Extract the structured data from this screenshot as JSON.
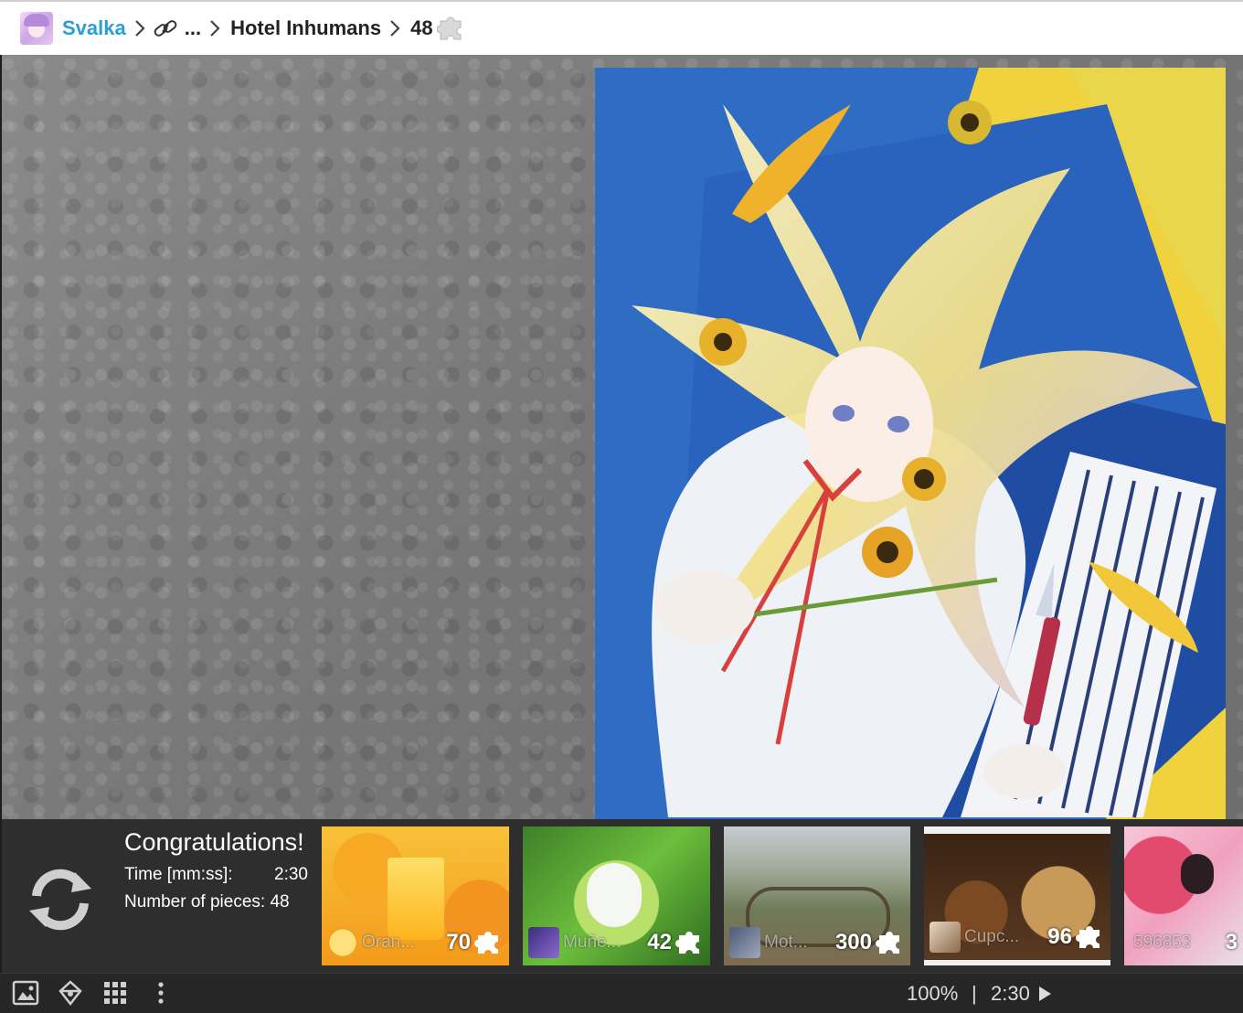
{
  "breadcrumb": {
    "user": "Svalka",
    "ellipsis": "...",
    "collection": "Hotel Inhumans",
    "pieces": "48"
  },
  "result": {
    "title": "Congratulations!",
    "time_label": "Time [mm:ss]:",
    "time_value": "2:30",
    "pieces_label": "Number of pieces: 48"
  },
  "suggestions": [
    {
      "name": "Oran...",
      "count": "70",
      "colors": [
        "#f39a1a",
        "#ffcf3a"
      ]
    },
    {
      "name": "Muñe...",
      "count": "42",
      "colors": [
        "#5aa832",
        "#b8e06a"
      ]
    },
    {
      "name": "Mot...",
      "count": "300",
      "colors": [
        "#7a7f68",
        "#c7ccd0"
      ]
    },
    {
      "name": "Cupc...",
      "count": "96",
      "colors": [
        "#3b2414",
        "#a87b4f"
      ]
    },
    {
      "name": "596853",
      "count": "3",
      "colors": [
        "#d8487a",
        "#f7c6d8"
      ]
    }
  ],
  "status": {
    "zoom": "100%",
    "divider": "|",
    "timer": "2:30"
  },
  "icons": [
    "image-icon",
    "shape-icon",
    "grid-icon",
    "more-icon",
    "refresh-icon",
    "puzzle-piece-icon",
    "link-icon",
    "play-icon"
  ]
}
